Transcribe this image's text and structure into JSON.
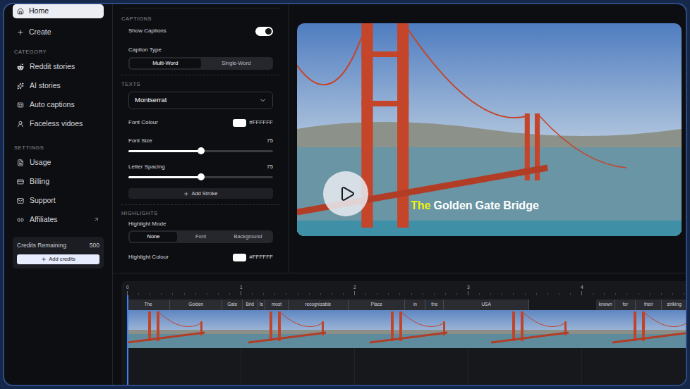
{
  "sidebar": {
    "top": [
      {
        "label": "Home",
        "selected": true
      },
      {
        "label": "Create",
        "selected": false
      }
    ],
    "sections": [
      {
        "title": "CATEGORY",
        "items": [
          {
            "label": "Reddit stories",
            "external": false
          },
          {
            "label": "AI stories",
            "external": false
          },
          {
            "label": "Auto captions",
            "external": false
          },
          {
            "label": "Faceless vidoes",
            "external": false
          }
        ]
      },
      {
        "title": "SETTINGS",
        "items": [
          {
            "label": "Usage",
            "external": false
          },
          {
            "label": "Billing",
            "external": false
          },
          {
            "label": "Support",
            "external": false
          },
          {
            "label": "Affiliates",
            "external": true
          }
        ]
      }
    ],
    "credits": {
      "label": "Credits Remaining",
      "value": "500",
      "button": "Add credits"
    }
  },
  "captions": {
    "header": "CAPTIONS",
    "show": {
      "label": "Show Captions",
      "on": true
    },
    "caption_type": {
      "label": "Caption Type",
      "options": [
        {
          "label": "Multi-Word",
          "selected": true
        },
        {
          "label": "Single-Word",
          "selected": false
        }
      ]
    }
  },
  "texts": {
    "header": "TEXTS",
    "font": "Montserrat",
    "font_colour": {
      "label": "Font Colour",
      "value": "#FFFFFF",
      "color": "#FFFFFF"
    },
    "font_size": {
      "label": "Font Size",
      "reading": "75",
      "level": 0.5
    },
    "letter_spacing": {
      "label": "Letter Spacing",
      "reading": "75",
      "level": 0.5
    },
    "add_stroke": "Add Stroke"
  },
  "highlights": {
    "header": "HIGHLIGHTS",
    "mode": {
      "label": "Highlight Mode",
      "options": [
        {
          "label": "None",
          "selected": true
        },
        {
          "label": "Font",
          "selected": false
        },
        {
          "label": "Background",
          "selected": false
        }
      ]
    },
    "colour": {
      "label": "Highlight Colour",
      "value": "#FFFFFF",
      "color": "#FFFFFF"
    }
  },
  "preview": {
    "playing": false,
    "caption": [
      {
        "word": "The",
        "highlighted": true,
        "color": "#F2F20A"
      },
      {
        "word": "Golden",
        "highlighted": false,
        "color": "#FFFFFF"
      },
      {
        "word": "Gate",
        "highlighted": false,
        "color": "#FFFFFF"
      },
      {
        "word": "Bridge",
        "highlighted": false,
        "color": "#FFFFFF"
      }
    ]
  },
  "timeline": {
    "ticks": [
      "0",
      "1",
      "2",
      "3",
      "4"
    ],
    "playhead": 0,
    "words": [
      {
        "word": "The",
        "start": 0,
        "end": 0.38
      },
      {
        "word": "Golden",
        "start": 0.38,
        "end": 0.84
      },
      {
        "word": "Gate",
        "start": 0.84,
        "end": 1.02
      },
      {
        "word": "Brid",
        "start": 1.02,
        "end": 1.15
      },
      {
        "word": "Is",
        "start": 1.15,
        "end": 1.22
      },
      {
        "word": "most",
        "start": 1.22,
        "end": 1.42
      },
      {
        "word": "recognizable",
        "start": 1.42,
        "end": 1.95
      },
      {
        "word": "Place",
        "start": 1.95,
        "end": 2.45
      },
      {
        "word": "in",
        "start": 2.45,
        "end": 2.63
      },
      {
        "word": "the",
        "start": 2.63,
        "end": 2.79
      },
      {
        "word": "USA",
        "start": 2.79,
        "end": 3.54
      },
      {
        "word": "known",
        "start": 4.13,
        "end": 4.3
      },
      {
        "word": "for",
        "start": 4.3,
        "end": 4.48
      },
      {
        "word": "their",
        "start": 4.48,
        "end": 4.71
      },
      {
        "word": "striking",
        "start": 4.71,
        "end": 4.93
      }
    ]
  }
}
